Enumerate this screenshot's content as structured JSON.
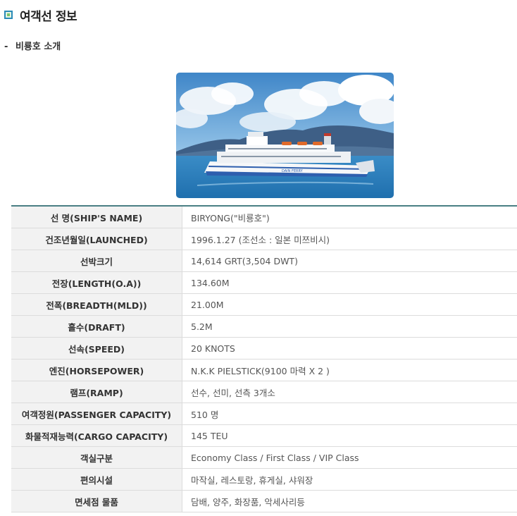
{
  "page": {
    "title": "여객선 정보",
    "subtitle_dash": "-",
    "subtitle": "비룡호 소개"
  },
  "photo": {
    "description_icon": "ship-photo",
    "hull_text": "DAIN FERRY",
    "colors": {
      "sky": "#5a9bd0",
      "sea": "#2f7fbf",
      "mountain": "#3e5f86"
    }
  },
  "specs": [
    {
      "label": "선 명(SHIP'S NAME)",
      "value": "BIRYONG(\"비룡호\")"
    },
    {
      "label": "건조년월일(LAUNCHED)",
      "value": "1996.1.27 (조선소 : 일본 미쯔비시)"
    },
    {
      "label": "선박크기",
      "value": "14,614 GRT(3,504 DWT)"
    },
    {
      "label": "전장(LENGTH(O.A))",
      "value": "134.60M"
    },
    {
      "label": "전폭(BREADTH(MLD))",
      "value": "21.00M"
    },
    {
      "label": "흘수(DRAFT)",
      "value": "5.2M"
    },
    {
      "label": "선속(SPEED)",
      "value": "20 KNOTS"
    },
    {
      "label": "엔진(HORSEPOWER)",
      "value": "N.K.K PIELSTICK(9100 마력 X 2 )"
    },
    {
      "label": "램프(RAMP)",
      "value": "선수, 선미, 선측 3개소"
    },
    {
      "label": "여객정원(PASSENGER CAPACITY)",
      "value": "510 명"
    },
    {
      "label": "화물적재능력(CARGO CAPACITY)",
      "value": "145 TEU"
    },
    {
      "label": "객실구분",
      "value": "Economy Class / First Class / VIP Class"
    },
    {
      "label": "편의시설",
      "value": "마작실, 레스토랑, 휴게실, 샤워장"
    },
    {
      "label": "면세점 물품",
      "value": "담배, 양주, 화장품, 악세사리등"
    }
  ]
}
